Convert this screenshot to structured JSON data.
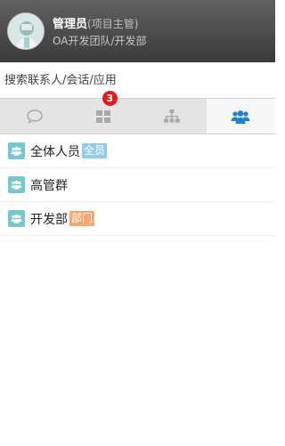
{
  "user": {
    "name": "管理员",
    "role": "(项目主管)",
    "org": "OA开发团队/开发部"
  },
  "search": {
    "placeholder": "搜索联系人/会话/应用"
  },
  "tabs": [
    {
      "icon": "chat-bubble-icon",
      "badge": ""
    },
    {
      "icon": "apps-grid-icon",
      "badge": "3"
    },
    {
      "icon": "org-chart-icon",
      "badge": ""
    },
    {
      "icon": "group-icon",
      "badge": "",
      "active": true
    }
  ],
  "groups": [
    {
      "name": "全体人员",
      "tag": "全员",
      "tag_color": "#8fcbea"
    },
    {
      "name": "高管群",
      "tag": "",
      "tag_color": ""
    },
    {
      "name": "开发部",
      "tag": "部门",
      "tag_color": "#f6a76f"
    }
  ],
  "colors": {
    "accent": "#1e7fd6",
    "tab_inactive_icon": "#a9a9a9",
    "badge": "#e21c1c",
    "group_icon_bg": "#74c8cf"
  }
}
